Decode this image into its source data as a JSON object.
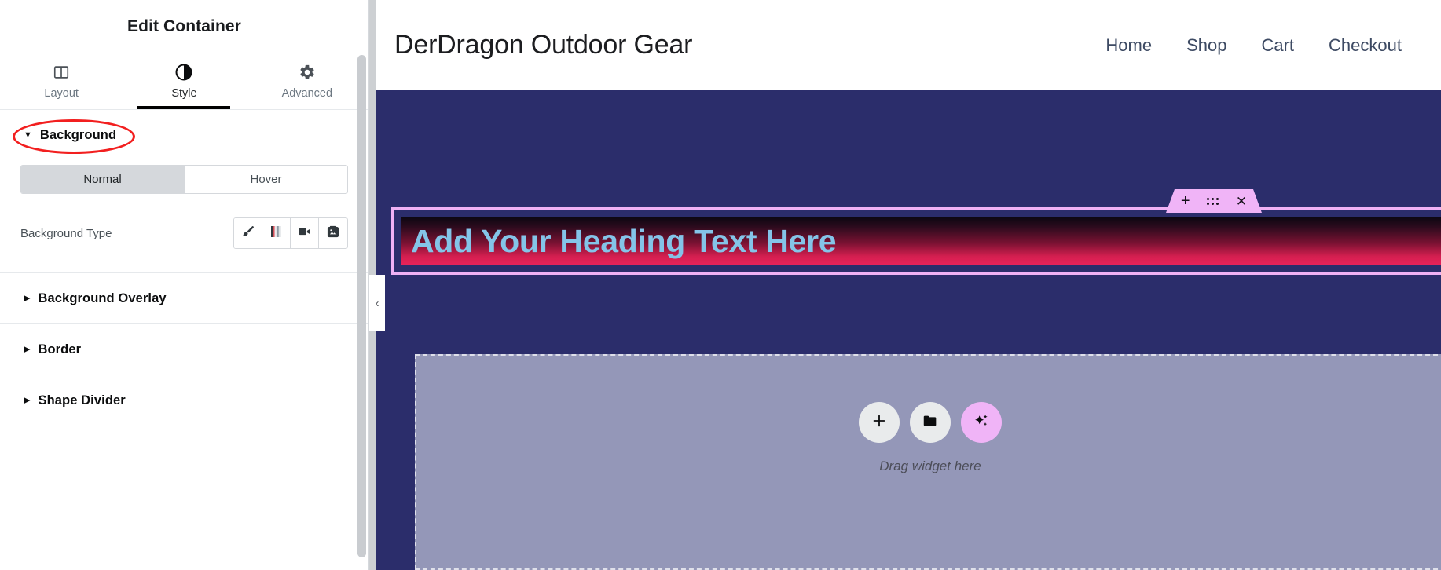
{
  "panel": {
    "title": "Edit Container",
    "tabs": [
      {
        "label": "Layout",
        "icon": "layout-columns-icon",
        "active": false
      },
      {
        "label": "Style",
        "icon": "half-circle-contrast-icon",
        "active": true
      },
      {
        "label": "Advanced",
        "icon": "gear-icon",
        "active": false
      }
    ],
    "sections": [
      {
        "id": "background",
        "title": "Background",
        "expanded": true,
        "annotated": true
      },
      {
        "id": "background-overlay",
        "title": "Background Overlay",
        "expanded": false,
        "annotated": false
      },
      {
        "id": "border",
        "title": "Border",
        "expanded": false,
        "annotated": false
      },
      {
        "id": "shape-divider",
        "title": "Shape Divider",
        "expanded": false,
        "annotated": false
      }
    ],
    "background_section": {
      "state_tabs": [
        {
          "label": "Normal",
          "selected": true
        },
        {
          "label": "Hover",
          "selected": false
        }
      ],
      "background_type": {
        "label": "Background Type",
        "choices": [
          {
            "icon": "paint-brush-icon",
            "title": "Classic",
            "selected": false
          },
          {
            "icon": "gradient-bars-icon",
            "title": "Gradient",
            "selected": false
          },
          {
            "icon": "video-camera-icon",
            "title": "Video",
            "selected": false
          },
          {
            "icon": "slideshow-image-icon",
            "title": "Slideshow",
            "selected": false
          }
        ]
      }
    },
    "annotation_color": "#f21f1f"
  },
  "preview": {
    "site_header": {
      "logo": "DerDragon Outdoor Gear",
      "nav": [
        {
          "label": "Home"
        },
        {
          "label": "Shop"
        },
        {
          "label": "Cart"
        },
        {
          "label": "Checkout"
        }
      ]
    },
    "canvas": {
      "background_color": "#2b2d6b",
      "heading_widget": {
        "text": "Add Your Heading Text Here",
        "text_color": "#84c4e8",
        "gradient_from": "#0a0710",
        "gradient_to": "#e8235a",
        "selection_border_color": "#efb1f4",
        "selected": true
      },
      "widget_toolbar": {
        "background_color": "#f0b4f7",
        "actions": [
          {
            "icon": "plus-icon",
            "label": "Add"
          },
          {
            "icon": "drag-dots-icon",
            "label": "Drag"
          },
          {
            "icon": "close-x-icon",
            "label": "Delete"
          }
        ]
      },
      "dropzone": {
        "label": "Drag widget here",
        "background_color": "#9497b8",
        "buttons": [
          {
            "icon": "plus-icon",
            "label": "Add new element",
            "accent": false
          },
          {
            "icon": "folder-icon",
            "label": "Add template",
            "accent": false
          },
          {
            "icon": "ai-sparkle-icon",
            "label": "Build with AI",
            "accent": true
          }
        ]
      }
    },
    "collapse_handle": {
      "icon": "chevron-left-icon"
    }
  }
}
